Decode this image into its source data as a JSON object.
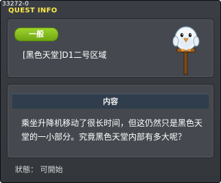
{
  "window": {
    "quest_id": "33272-0",
    "title": "QUEST INFO"
  },
  "quest": {
    "category": "一般",
    "name": "[黑色天堂]D1二号区域",
    "icon": "snowbird-signpost-icon"
  },
  "content": {
    "header": "内容",
    "description": "乘坐升降机移动了很长时间，但这仍然只是黑色天堂的一小部分。究竟黑色天堂内部有多大呢？"
  },
  "status": {
    "text": "狀態： 可開始"
  },
  "colors": {
    "title": "#ffe94a",
    "category_pill": "#8cc21f",
    "header_bar": "#2f3d4c",
    "background": "#3a3e44"
  }
}
